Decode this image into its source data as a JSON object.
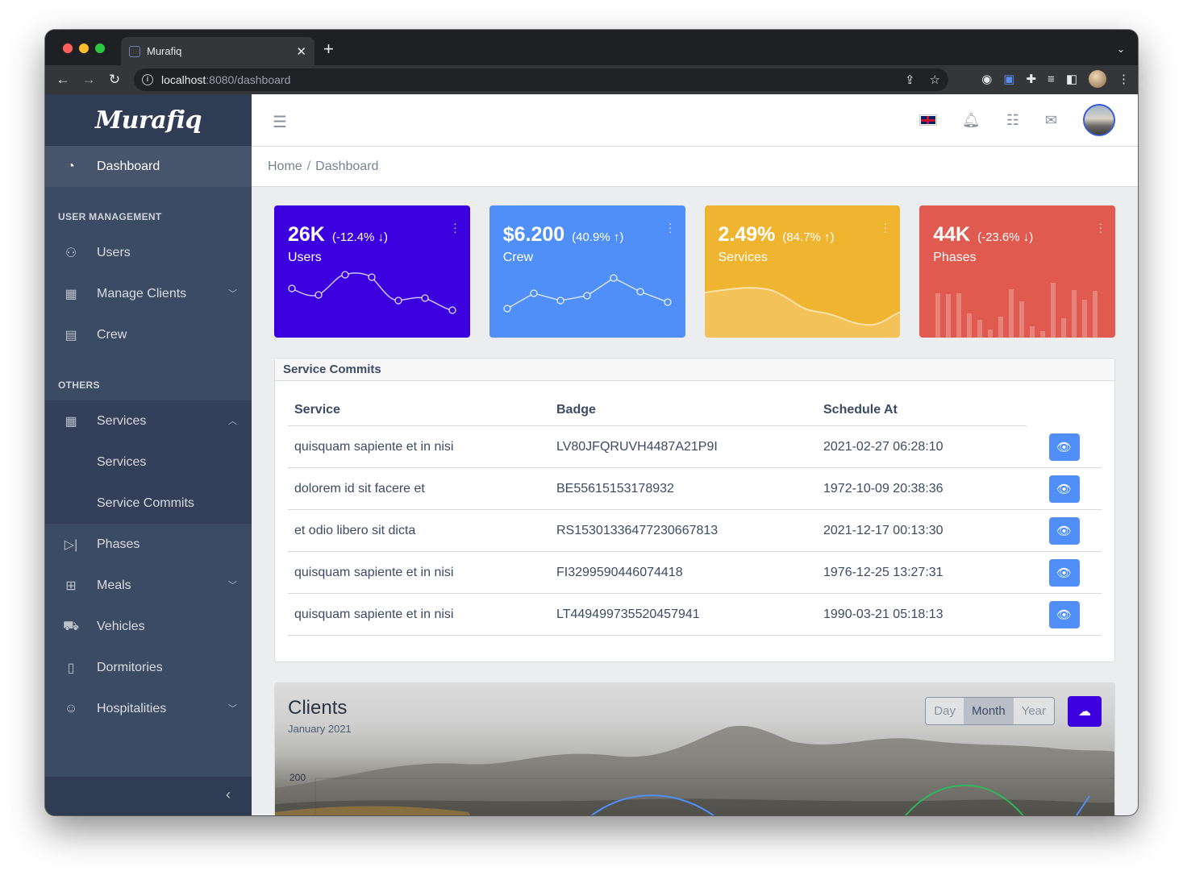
{
  "browser": {
    "tab_title": "Murafiq",
    "url_host": "localhost",
    "url_path": ":8080/dashboard"
  },
  "sidebar": {
    "brand": "Murafiq",
    "items": [
      {
        "label": "Dashboard",
        "icon": "speedometer-icon"
      },
      {
        "section": "USER MANAGEMENT"
      },
      {
        "label": "Users",
        "icon": "people-icon"
      },
      {
        "label": "Manage Clients",
        "icon": "building-icon"
      },
      {
        "label": "Crew",
        "icon": "contact-icon"
      },
      {
        "section": "OTHERS"
      },
      {
        "label": "Services",
        "icon": "building-icon"
      },
      {
        "label": "Services",
        "sub": true
      },
      {
        "label": "Service Commits",
        "sub": true
      },
      {
        "label": "Phases",
        "icon": "media-step-icon"
      },
      {
        "label": "Meals",
        "icon": "restaurant-icon"
      },
      {
        "label": "Vehicles",
        "icon": "truck-icon"
      },
      {
        "label": "Dormitories",
        "icon": "door-icon"
      },
      {
        "label": "Hospitalities",
        "icon": "smile-icon"
      }
    ]
  },
  "breadcrumb": {
    "home": "Home",
    "current": "Dashboard"
  },
  "widgets": [
    {
      "value": "26K",
      "change": "(-12.4% ↓)",
      "label": "Users",
      "color": "#3b00dd"
    },
    {
      "value": "$6.200",
      "change": "(40.9% ↑)",
      "label": "Crew",
      "color": "#4f8ff7"
    },
    {
      "value": "2.49%",
      "change": "(84.7% ↑)",
      "label": "Services",
      "color": "#f0b530"
    },
    {
      "value": "44K",
      "change": "(-23.6% ↓)",
      "label": "Phases",
      "color": "#e05a4f"
    }
  ],
  "commits": {
    "title": "Service Commits",
    "columns": [
      "Service",
      "Badge",
      "Schedule At"
    ],
    "rows": [
      [
        "quisquam sapiente et in nisi",
        "LV80JFQRUVH4487A21P9I",
        "2021-02-27 06:28:10"
      ],
      [
        "dolorem id sit facere et",
        "BE55615153178932",
        "1972-10-09 20:38:36"
      ],
      [
        "et odio libero sit dicta",
        "RS15301336477230667813",
        "2021-12-17 00:13:30"
      ],
      [
        "quisquam sapiente et in nisi",
        "FI3299590446074418",
        "1976-12-25 13:27:31"
      ],
      [
        "quisquam sapiente et in nisi",
        "LT449499735520457941",
        "1990-03-21 05:18:13"
      ]
    ]
  },
  "clients": {
    "title": "Clients",
    "subtitle": "January 2021",
    "ranges": [
      "Day",
      "Month",
      "Year"
    ],
    "selected_range": "Month",
    "y_tick": "200"
  }
}
